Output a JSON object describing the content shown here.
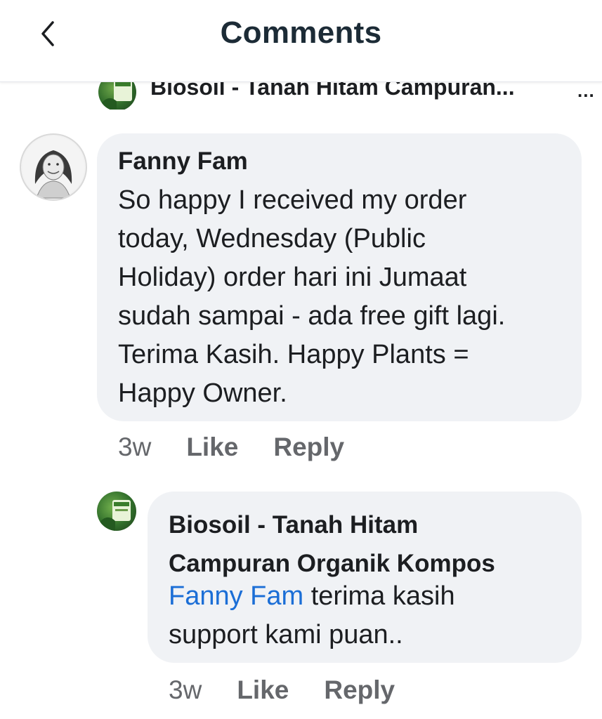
{
  "header": {
    "title": "Comments",
    "back_icon": "chevron-left-icon"
  },
  "previous_item": {
    "name": "Biosoil - Tanah Hitam Campuran...",
    "more": "..."
  },
  "comment": {
    "author": "Fanny Fam",
    "lines": [
      "So happy I received my order",
      "today, Wednesday (Public",
      "Holiday) order hari ini Jumaat",
      "sudah sampai - ada free gift lagi.",
      "Terima Kasih. Happy Plants =",
      "Happy Owner."
    ],
    "time": "3w",
    "like_label": "Like",
    "reply_label": "Reply"
  },
  "reply": {
    "author_line1": "Biosoil - Tanah Hitam",
    "author_line2": "Campuran Organik Kompos",
    "mention": "Fanny Fam",
    "text_line1_rest": " terima kasih",
    "text_line2": "support kami puan..",
    "time": "3w",
    "like_label": "Like",
    "reply_label": "Reply"
  },
  "colors": {
    "bubble": "#f0f2f5",
    "mention": "#1b6ed6",
    "secondary_text": "#65676b",
    "title": "#1c2b36"
  }
}
